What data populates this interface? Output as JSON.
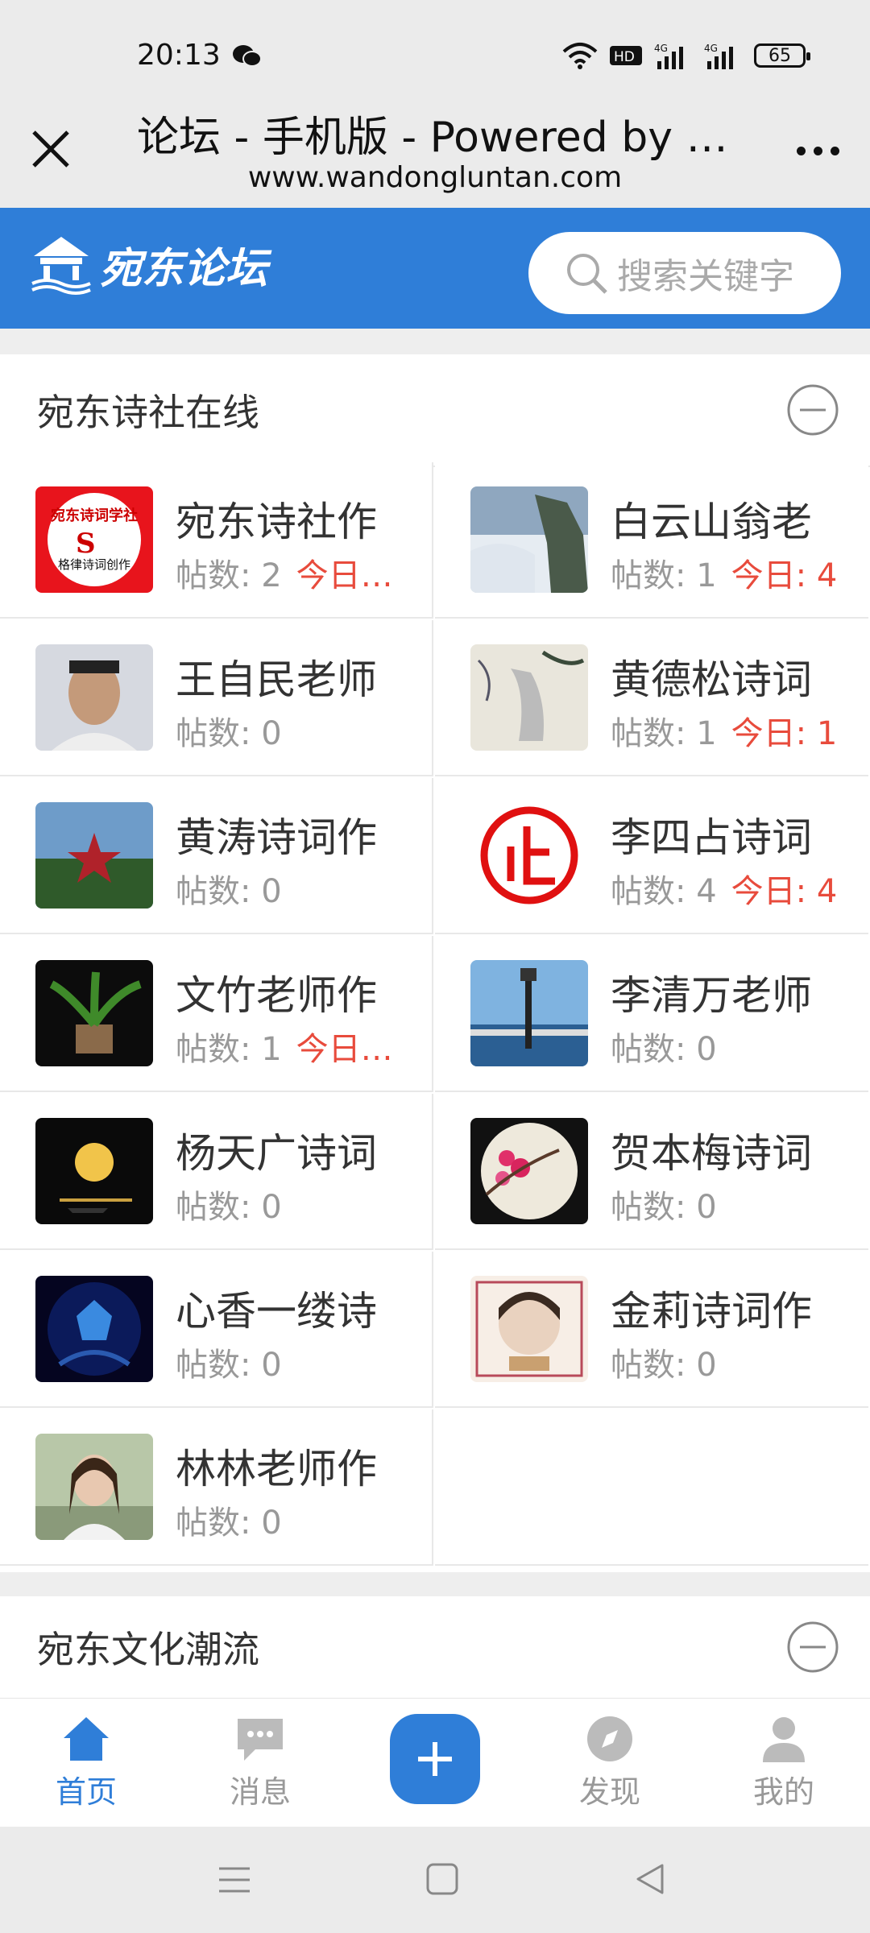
{
  "status_bar": {
    "time": "20:13",
    "battery": "65"
  },
  "browser": {
    "title": "论坛 - 手机版 - Powered by Di...",
    "url": "www.wandongluntan.com"
  },
  "header": {
    "logo_text": "宛东论坛",
    "search_placeholder": "搜索关键字"
  },
  "sections": [
    {
      "title": "宛东诗社在线"
    },
    {
      "title": "宛东文化潮流"
    }
  ],
  "forums": [
    {
      "name": "宛东诗社作",
      "posts": "帖数: 2",
      "today": "今日:..."
    },
    {
      "name": "白云山翁老",
      "posts": "帖数: 1",
      "today": "今日: 4"
    },
    {
      "name": "王自民老师",
      "posts": "帖数: 0",
      "today": ""
    },
    {
      "name": "黄德松诗词",
      "posts": "帖数: 1",
      "today": "今日: 1"
    },
    {
      "name": "黄涛诗词作",
      "posts": "帖数: 0",
      "today": ""
    },
    {
      "name": "李四占诗词",
      "posts": "帖数: 4",
      "today": "今日: 4"
    },
    {
      "name": "文竹老师作",
      "posts": "帖数: 1",
      "today": "今日:..."
    },
    {
      "name": "李清万老师",
      "posts": "帖数: 0",
      "today": ""
    },
    {
      "name": "杨天广诗词",
      "posts": "帖数: 0",
      "today": ""
    },
    {
      "name": "贺本梅诗词",
      "posts": "帖数: 0",
      "today": ""
    },
    {
      "name": "心香一缕诗",
      "posts": "帖数: 0",
      "today": ""
    },
    {
      "name": "金莉诗词作",
      "posts": "帖数: 0",
      "today": ""
    },
    {
      "name": "林林老师作",
      "posts": "帖数: 0",
      "today": ""
    }
  ],
  "thumb_text": {
    "seal": "宛东诗词学社",
    "seal_sub": "格律诗词创作"
  },
  "bottom_nav": {
    "home": "首页",
    "messages": "消息",
    "discover": "发现",
    "mine": "我的"
  },
  "colors": {
    "brand": "#2f7ed8",
    "today": "#e84b3c"
  }
}
